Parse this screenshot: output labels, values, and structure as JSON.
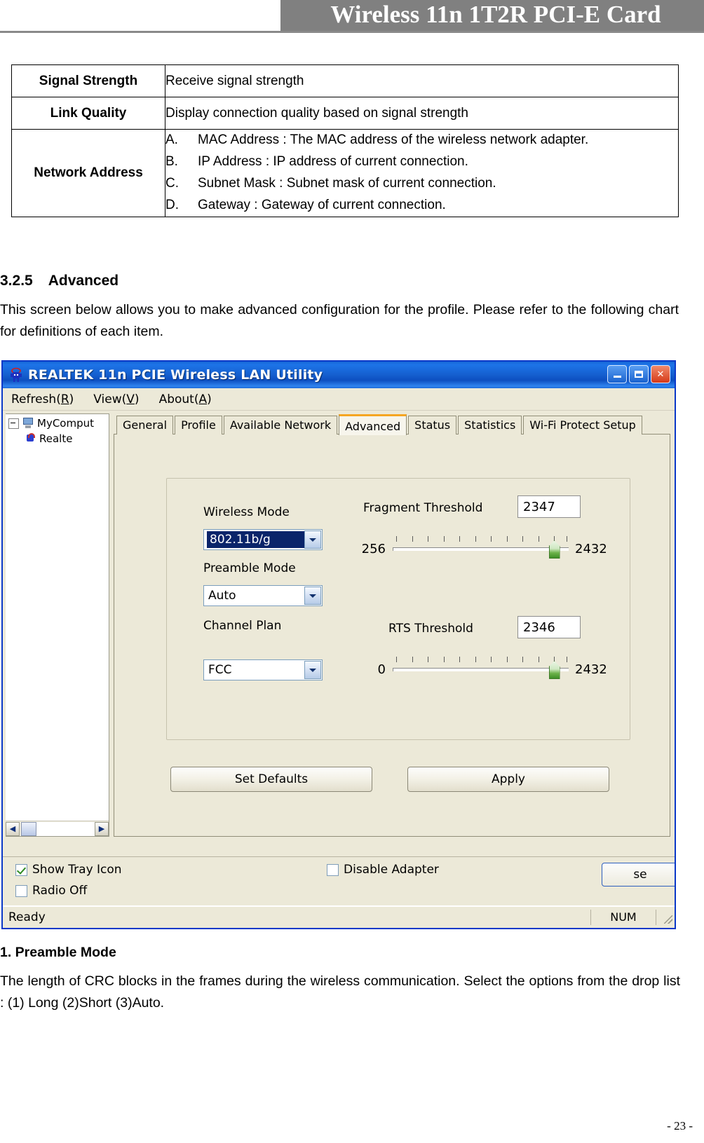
{
  "header": {
    "title": "Wireless 11n 1T2R PCI-E Card"
  },
  "definition_table": {
    "rows": [
      {
        "label": "Signal Strength",
        "value": "Receive signal strength"
      },
      {
        "label": "Link Quality",
        "value": "Display connection quality based on signal strength"
      },
      {
        "label": "Network Address",
        "items": [
          {
            "key": "A.",
            "text": "MAC Address : The MAC address of the wireless network adapter."
          },
          {
            "key": "B.",
            "text": "IP Address : IP address of current connection."
          },
          {
            "key": "C.",
            "text": "Subnet Mask : Subnet mask of current connection."
          },
          {
            "key": "D.",
            "text": "Gateway : Gateway of current connection."
          }
        ]
      }
    ]
  },
  "section": {
    "number": "3.2.5",
    "title": "Advanced",
    "paragraph": "This screen below allows you to make advanced configuration for the profile. Please refer to the following chart for definitions of each item."
  },
  "app": {
    "titlebar": {
      "title": "REALTEK 11n PCIE Wireless LAN Utility",
      "icon": "realtek-logo-icon",
      "minimize_label": "_",
      "maximize_label": "□",
      "close_label": "✕"
    },
    "menu": [
      {
        "text": "Refresh(",
        "accel": "R",
        "tail": ")"
      },
      {
        "text": "View(",
        "accel": "V",
        "tail": ")"
      },
      {
        "text": "About(",
        "accel": "A",
        "tail": ")"
      }
    ],
    "tree": {
      "root": "MyComput",
      "child": "Realte"
    },
    "tabs": [
      {
        "label": "General",
        "active": false
      },
      {
        "label": "Profile",
        "active": false
      },
      {
        "label": "Available Network",
        "active": false
      },
      {
        "label": "Advanced",
        "active": true
      },
      {
        "label": "Status",
        "active": false
      },
      {
        "label": "Statistics",
        "active": false
      },
      {
        "label": "Wi-Fi Protect Setup",
        "active": false
      }
    ],
    "advanced": {
      "wireless_mode_label": "Wireless Mode",
      "wireless_mode_value": "802.11b/g",
      "preamble_mode_label": "Preamble Mode",
      "preamble_mode_value": "Auto",
      "channel_plan_label": "Channel Plan",
      "channel_plan_value": "FCC",
      "fragment_threshold_label": "Fragment Threshold",
      "fragment_threshold_value": "2347",
      "fragment_min": "256",
      "fragment_max": "2432",
      "rts_threshold_label": "RTS Threshold",
      "rts_threshold_value": "2346",
      "rts_min": "0",
      "rts_max": "2432",
      "set_defaults_label": "Set Defaults",
      "apply_label": "Apply"
    },
    "bottom": {
      "show_tray_icon_label": "Show Tray Icon",
      "show_tray_icon_checked": true,
      "radio_off_label": "Radio Off",
      "radio_off_checked": false,
      "disable_adapter_label": "Disable Adapter",
      "disable_adapter_checked": false,
      "close_label": "se"
    },
    "statusbar": {
      "ready": "Ready",
      "num": "NUM"
    }
  },
  "footer_section": {
    "heading": "1. Preamble Mode",
    "paragraph": "The length of CRC blocks in the frames during the wireless communication. Select the options from the drop list : (1) Long    (2)Short    (3)Auto."
  },
  "page": {
    "number": "- 23 -"
  },
  "colors": {
    "header_band": "#808080",
    "titlebar_blue": "#1560d0",
    "window_face": "#ece9d8",
    "active_tab_accent": "#f5a623",
    "slider_thumb_green": "#3f8f28",
    "combo_selection": "#0a246a"
  }
}
